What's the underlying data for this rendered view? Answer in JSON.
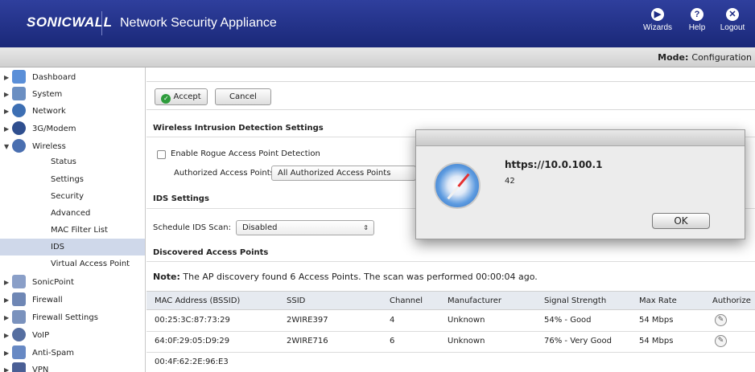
{
  "header": {
    "logo": "SONICWALL",
    "product": "Network Security Appliance",
    "buttons": [
      {
        "label": "Wizards",
        "icon": "wizard-icon"
      },
      {
        "label": "Help",
        "icon": "help-icon"
      },
      {
        "label": "Logout",
        "icon": "logout-icon"
      }
    ]
  },
  "modebar": {
    "label": "Mode:",
    "value": "Configuration"
  },
  "sidebar": {
    "items": [
      {
        "label": "Dashboard",
        "icon": "dashboard-icon",
        "color": "#5a8fd8"
      },
      {
        "label": "System",
        "icon": "system-icon",
        "color": "#6b8fc2"
      },
      {
        "label": "Network",
        "icon": "network-icon",
        "color": "#3d6fb3"
      },
      {
        "label": "3G/Modem",
        "icon": "modem-icon",
        "color": "#2f4f8f"
      },
      {
        "label": "Wireless",
        "icon": "wireless-icon",
        "color": "#4a6fb0"
      },
      {
        "label": "SonicPoint",
        "icon": "sonicpoint-icon",
        "color": "#8a9fc8"
      },
      {
        "label": "Firewall",
        "icon": "firewall-icon",
        "color": "#6f87b5"
      },
      {
        "label": "Firewall Settings",
        "icon": "firewall-settings-icon",
        "color": "#7a92bd"
      },
      {
        "label": "VoIP",
        "icon": "voip-icon",
        "color": "#556ea0"
      },
      {
        "label": "Anti-Spam",
        "icon": "anti-spam-icon",
        "color": "#6789c4"
      },
      {
        "label": "VPN",
        "icon": "vpn-icon",
        "color": "#4a5f95"
      }
    ],
    "wireless_sub": [
      "Status",
      "Settings",
      "Security",
      "Advanced",
      "MAC Filter List",
      "IDS",
      "Virtual Access Point"
    ],
    "active_sub": "IDS"
  },
  "toolbar": {
    "accept": "Accept",
    "cancel": "Cancel"
  },
  "wids": {
    "title": "Wireless Intrusion Detection Settings",
    "rogue_label": "Enable Rogue Access Point Detection",
    "authorized_label": "Authorized Access Points:",
    "authorized_value": "All Authorized Access Points"
  },
  "ids": {
    "title": "IDS Settings",
    "schedule_label": "Schedule IDS Scan:",
    "schedule_value": "Disabled"
  },
  "discovered": {
    "title": "Discovered Access Points",
    "note_label": "Note:",
    "note_text": "The AP discovery found 6 Access Points. The scan was performed 00:00:04 ago.",
    "columns": [
      "MAC Address (BSSID)",
      "SSID",
      "Channel",
      "Manufacturer",
      "Signal Strength",
      "Max Rate",
      "Authorize"
    ],
    "rows": [
      [
        "00:25:3C:87:73:29",
        "2WIRE397",
        "4",
        "Unknown",
        "54% - Good",
        "54 Mbps"
      ],
      [
        "64:0F:29:05:D9:29",
        "2WIRE716",
        "6",
        "Unknown",
        "76% - Very Good",
        "54 Mbps"
      ],
      [
        "00:4F:62:2E:96:E3",
        "",
        "",
        "",
        "",
        ""
      ]
    ]
  },
  "dialog": {
    "title": "https://10.0.100.1",
    "message": "42",
    "ok": "OK"
  }
}
